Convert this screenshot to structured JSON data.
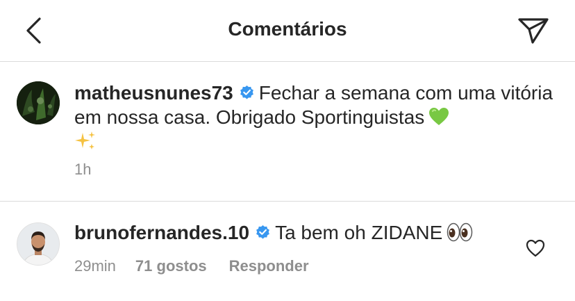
{
  "header": {
    "title": "Comentários",
    "back_icon": "chevron-left-icon",
    "share_icon": "paper-plane-icon"
  },
  "caption": {
    "username": "matheusnunes73",
    "verified": true,
    "text": "Fechar a semana com uma vitória em nossa casa. Obrigado Sportinguistas",
    "emojis": [
      "green-heart-icon",
      "sparkles-icon"
    ],
    "time": "1h"
  },
  "comment": {
    "username": "brunofernandes.10",
    "verified": true,
    "text": "Ta bem oh ZIDANE",
    "emoji": "eyes-icon",
    "time": "29min",
    "likes": "71 gostos",
    "reply_label": "Responder",
    "like_icon": "heart-outline-icon"
  },
  "colors": {
    "text": "#262626",
    "secondary": "#8e8e8e",
    "verified": "#3897f0",
    "divider": "#dbdbdb"
  }
}
